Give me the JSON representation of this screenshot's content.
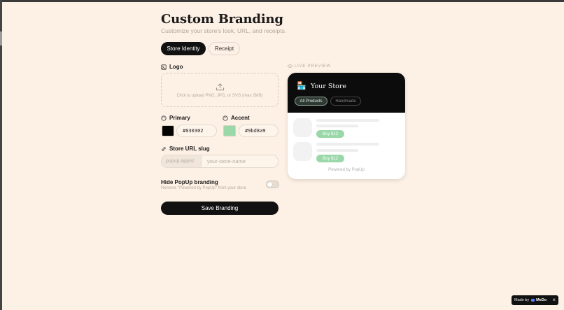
{
  "header": {
    "title": "Custom Branding",
    "subtitle": "Customize your store's look, URL, and receipts."
  },
  "tabs": [
    {
      "label": "Store Identity",
      "active": true
    },
    {
      "label": "Receipt",
      "active": false
    }
  ],
  "logo": {
    "label": "Logo",
    "upload_hint": "Click to upload PNG, JPG, or SVG (max 2MB)"
  },
  "colors": {
    "primary_label": "Primary",
    "primary_value": "#030302",
    "accent_label": "Accent",
    "accent_value": "#9bd8a9"
  },
  "url_slug": {
    "label": "Store URL slug",
    "prefix": "popup.app/s/",
    "placeholder": "your-store-name"
  },
  "hide_branding": {
    "title": "Hide PopUp branding",
    "description": "Remove \"Powered by PopUp\" from your store",
    "enabled": false
  },
  "save_label": "Save Branding",
  "preview": {
    "label": "LIVE PREVIEW",
    "store_name": "Your Store",
    "store_icon": "storefront-icon",
    "pills": [
      "All Products",
      "Handmade"
    ],
    "buy_labels": [
      "Buy $12",
      "Buy $12"
    ],
    "powered_by": "Powered by PopUp"
  },
  "badge": {
    "made_by": "Made by",
    "brand": "MeDo"
  },
  "theme": {
    "background": "#fdf0e4",
    "primary": "#030302",
    "accent": "#9bd8a9"
  }
}
